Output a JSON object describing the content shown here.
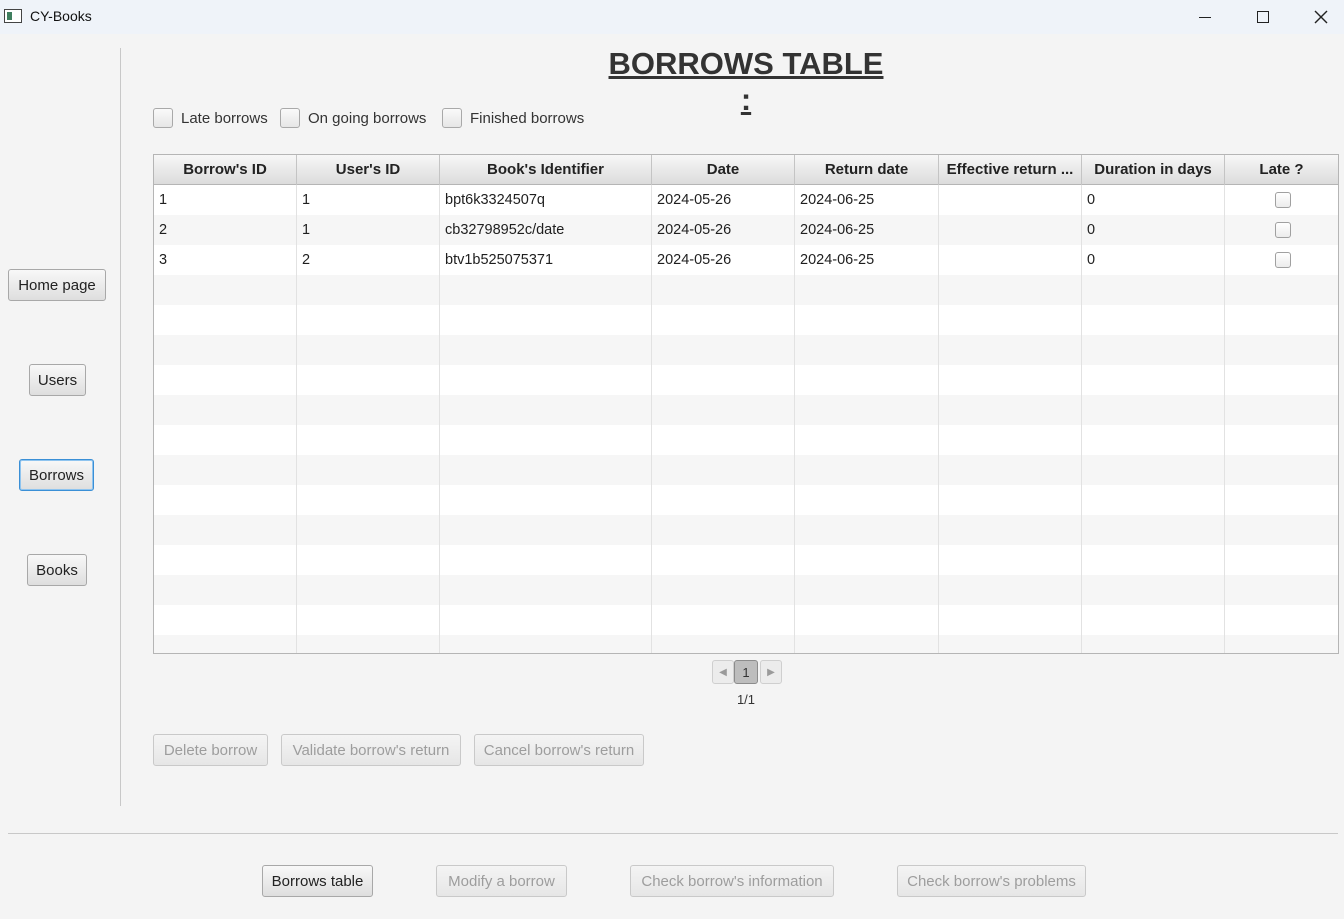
{
  "window": {
    "title": "CY-Books",
    "controls": [
      "minimize-icon",
      "maximize-icon",
      "close-icon"
    ]
  },
  "sidebar": {
    "items": [
      {
        "label": "Home page"
      },
      {
        "label": "Users"
      },
      {
        "label": "Borrows",
        "focused": true
      },
      {
        "label": "Books"
      }
    ]
  },
  "main": {
    "title": "BORROWS TABLE :",
    "filters": [
      {
        "label": "Late borrows",
        "checked": false
      },
      {
        "label": "On going borrows",
        "checked": false
      },
      {
        "label": "Finished borrows",
        "checked": false
      }
    ],
    "table": {
      "columns": [
        "Borrow's ID",
        "User's ID",
        "Book's Identifier",
        "Date",
        "Return date",
        "Effective return ...",
        "Duration in days",
        "Late ?"
      ],
      "rows": [
        {
          "borrow_id": "1",
          "user_id": "1",
          "book_identifier": "bpt6k3324507q",
          "date": "2024-05-26",
          "return_date": "2024-06-25",
          "effective_return": "",
          "duration": "0",
          "late": false
        },
        {
          "borrow_id": "2",
          "user_id": "1",
          "book_identifier": "cb32798952c/date",
          "date": "2024-05-26",
          "return_date": "2024-06-25",
          "effective_return": "",
          "duration": "0",
          "late": false
        },
        {
          "borrow_id": "3",
          "user_id": "2",
          "book_identifier": "btv1b525075371",
          "date": "2024-05-26",
          "return_date": "2024-06-25",
          "effective_return": "",
          "duration": "0",
          "late": false
        }
      ]
    },
    "pagination": {
      "current_page": "1",
      "label": "1/1",
      "prev_icon": "chevron-left-icon",
      "next_icon": "chevron-right-icon"
    },
    "actions": {
      "delete": "Delete borrow",
      "validate": "Validate borrow's return",
      "cancel": "Cancel borrow's return"
    }
  },
  "bottom_nav": {
    "borrows_table": "Borrows table",
    "modify": "Modify a borrow",
    "check_info": "Check borrow's information",
    "check_problems": "Check borrow's problems"
  },
  "colors": {
    "focus_border": "#3a8fd6",
    "background": "#f4f4f4",
    "titlebar": "#eff3f9",
    "disabled_text": "#9d9d9d"
  }
}
